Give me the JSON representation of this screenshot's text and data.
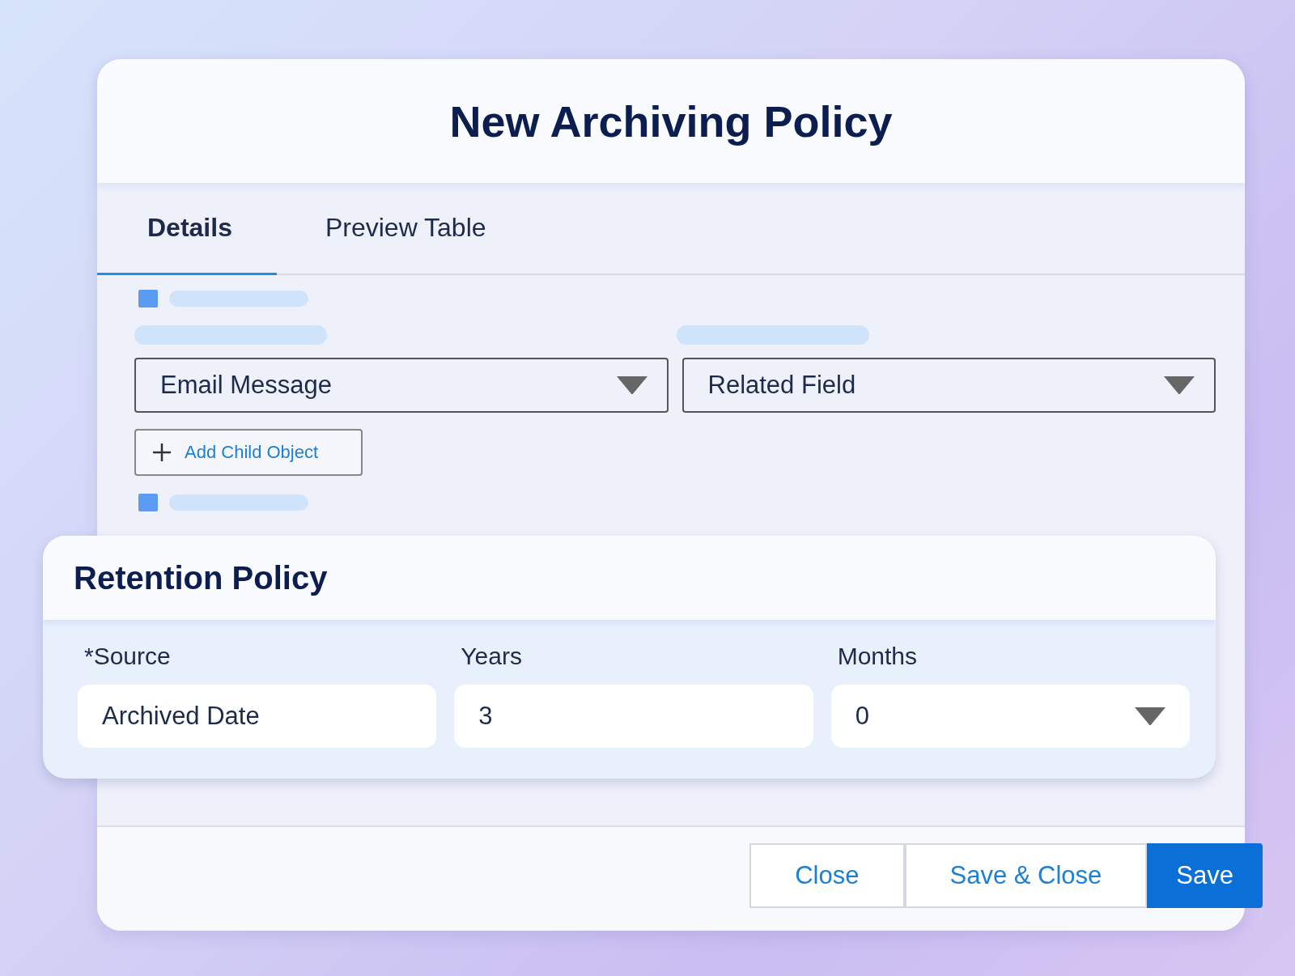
{
  "dialog": {
    "title": "New Archiving Policy"
  },
  "tabs": [
    {
      "label": "Details",
      "selected": true
    },
    {
      "label": "Preview Table",
      "selected": false
    }
  ],
  "selects": [
    {
      "value": "Email Message"
    },
    {
      "value": "Related Field"
    }
  ],
  "add_child_button": {
    "label": "Add Child Object"
  },
  "retention_policy": {
    "title": "Retention Policy",
    "fields": [
      {
        "label": "*Source",
        "value": "Archived Date",
        "kind": "text"
      },
      {
        "label": "Years",
        "value": "3",
        "kind": "text"
      },
      {
        "label": "Months",
        "value": "0",
        "kind": "select"
      }
    ]
  },
  "buttons": [
    {
      "label": "Close",
      "kind": "secondary"
    },
    {
      "label": "Save & Close",
      "kind": "secondary"
    },
    {
      "label": "Save",
      "kind": "primary"
    }
  ]
}
